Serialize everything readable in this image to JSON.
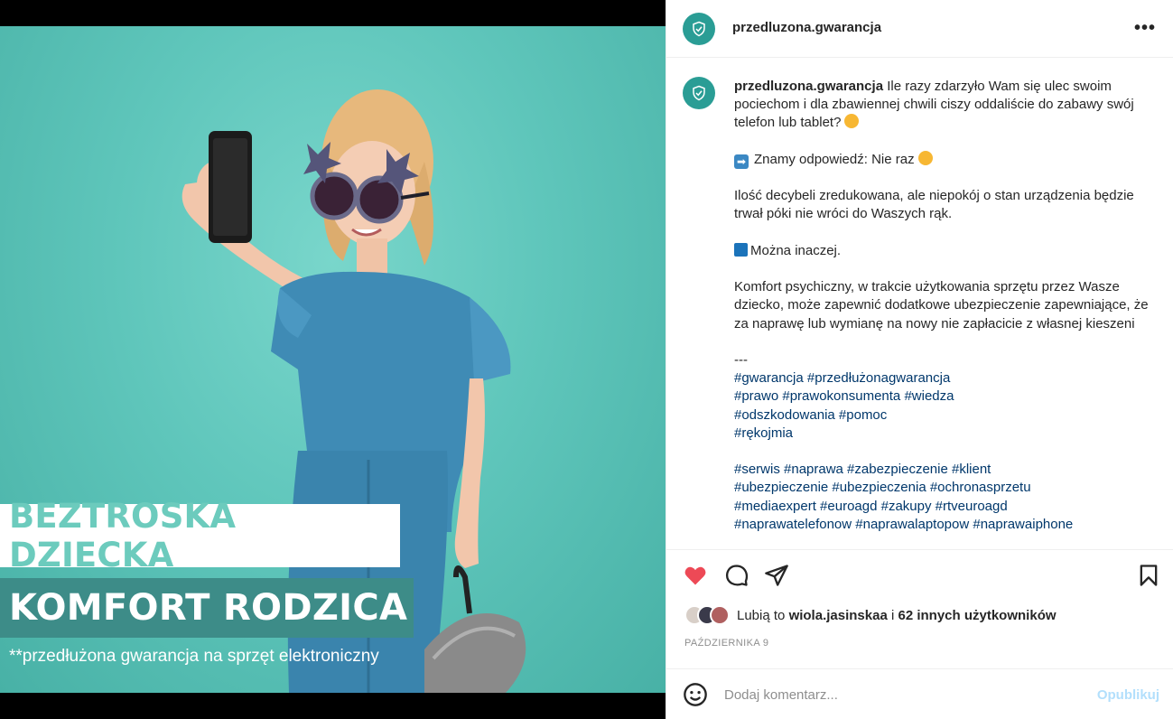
{
  "account": {
    "username": "przedluzona.gwarancja"
  },
  "media": {
    "banner_top": "BEZTROSKA DZIECKA",
    "banner_bottom": "KOMFORT RODZICA",
    "overlay_caption": "**przedłużona gwarancja na sprzęt elektroniczny"
  },
  "header": {
    "more_label": "•••"
  },
  "caption": {
    "username": "przedluzona.gwarancja",
    "intro": "Ile razy zdarzyło Wam się ulec swoim pociechom i dla zbawiennej chwili ciszy oddaliście do zabawy swój telefon lub tablet?",
    "answer": "Znamy odpowiedź: Nie raz",
    "para2": "Ilość decybeli zredukowana, ale niepokój o stan urządzenia będzie trwał póki nie wróci do Waszych rąk.",
    "para3": "Można inaczej.",
    "para4": "Komfort psychiczny, w trakcie użytkowania sprzętu przez Wasze dziecko, może zapewnić dodatkowe ubezpieczenie zapewniające, że za naprawę lub wymianę na nowy nie zapłacicie z własnej kieszeni",
    "separator": "---",
    "tags_1": [
      "#gwarancja #przedłużonagwarancja",
      "#prawo #prawokonsumenta #wiedza",
      "#odszkodowania #pomoc",
      "#rękojmia"
    ],
    "tags_2": [
      "#serwis #naprawa #zabezpieczenie #klient",
      "#ubezpieczenie #ubezpieczenia #ochronasprzetu",
      "#mediaexpert #euroagd #zakupy #rtveuroagd",
      "#naprawatelefonow #naprawalaptopow #naprawaiphone"
    ]
  },
  "likes": {
    "prefix": "Lubią to",
    "user": "wiola.jasinskaa",
    "connector": "i",
    "others": "62 innych użytkowników"
  },
  "date": "PAŹDZIERNIKA 9",
  "comment": {
    "placeholder": "Dodaj komentarz...",
    "publish_label": "Opublikuj"
  },
  "colors": {
    "brand": "#2a9d95",
    "like": "#ed4956",
    "tag": "#00376b",
    "publish": "#b2dffc"
  }
}
